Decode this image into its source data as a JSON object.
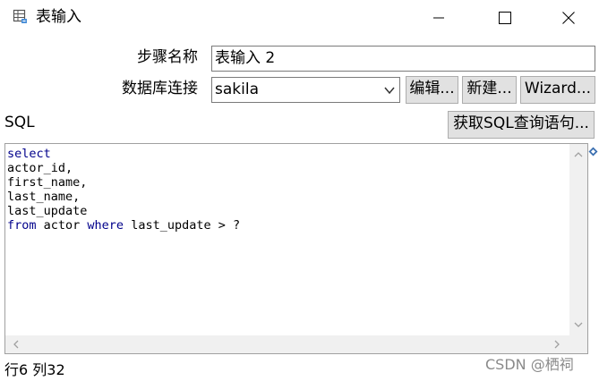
{
  "window": {
    "title": "表输入",
    "icon": "table-input-icon",
    "controls": [
      "minimize-icon",
      "maximize-icon",
      "close-icon"
    ]
  },
  "form": {
    "step_name_label": "步骤名称",
    "step_name_value": "表输入 2",
    "connection_label": "数据库连接",
    "connection_value": "sakila",
    "edit_button": "编辑...",
    "new_button": "新建...",
    "wizard_button": "Wizard...",
    "sql_label": "SQL",
    "get_sql_button": "获取SQL查询语句..."
  },
  "editor": {
    "lines": [
      [
        {
          "t": "select",
          "kw": true
        }
      ],
      [
        {
          "t": "actor_id,",
          "kw": false
        }
      ],
      [
        {
          "t": "first_name,",
          "kw": false
        }
      ],
      [
        {
          "t": "last_name,",
          "kw": false
        }
      ],
      [
        {
          "t": "last_update",
          "kw": false
        }
      ],
      [
        {
          "t": "from",
          "kw": true
        },
        {
          "t": " actor ",
          "kw": false
        },
        {
          "t": "where",
          "kw": true
        },
        {
          "t": " last_update > ?",
          "kw": false
        }
      ]
    ]
  },
  "status": {
    "position": "行6 列32"
  },
  "watermark": "CSDN @栖祠",
  "colors": {
    "keyword": "#00008b",
    "button_bg": "#e1e1e1",
    "border": "#7a7a7a"
  }
}
